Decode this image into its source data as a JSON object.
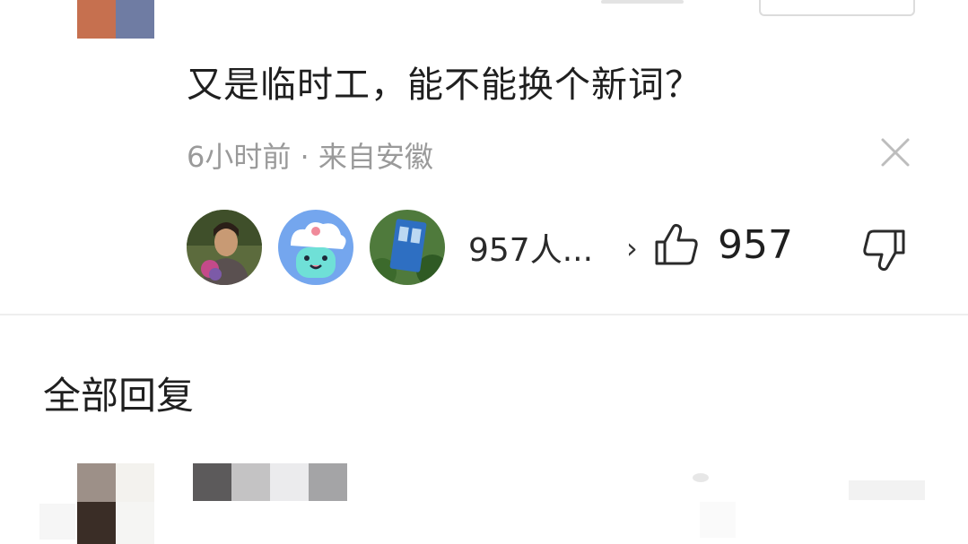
{
  "comment": {
    "text": "又是临时工，能不能换个新词？",
    "meta": "6小时前 · 来自安徽"
  },
  "likes": {
    "summary": "957人...",
    "chevron": "›",
    "count": "957"
  },
  "replies": {
    "section_title": "全部回复"
  },
  "colors": {
    "text_primary": "#1f1f1f",
    "text_secondary": "#9a9a9a",
    "divider": "#eeeeee"
  },
  "icons": {
    "close": "close-icon",
    "like": "thumbs-up-icon",
    "dislike": "thumbs-down-icon"
  }
}
